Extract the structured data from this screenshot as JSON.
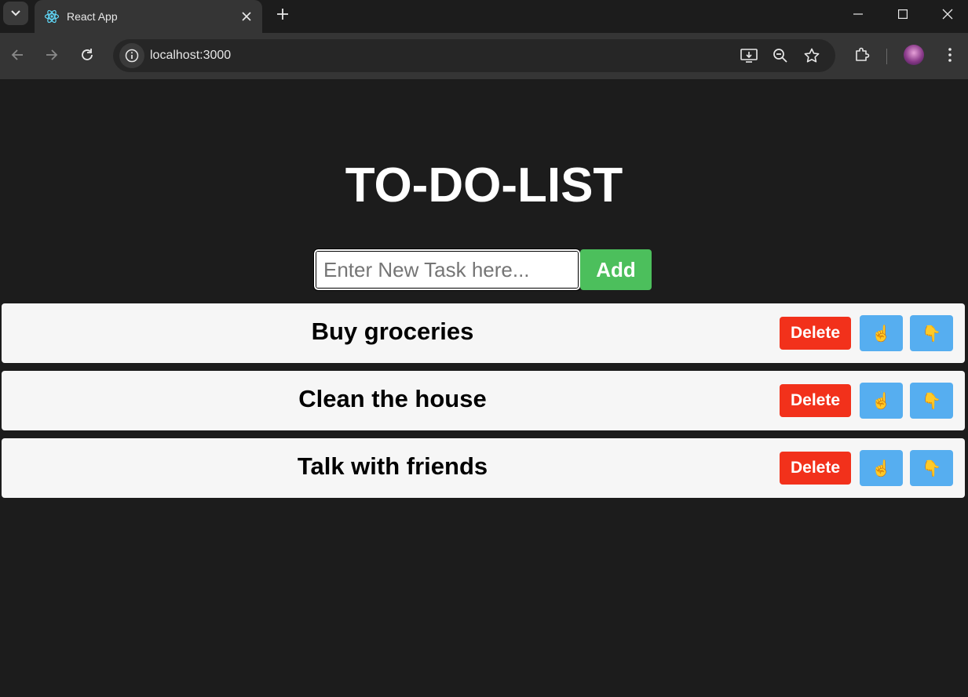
{
  "browser": {
    "tab_title": "React App",
    "url": "localhost:3000"
  },
  "app": {
    "title": "TO-DO-LIST",
    "input_placeholder": "Enter New Task here...",
    "input_value": "",
    "add_label": "Add",
    "delete_label": "Delete",
    "move_up_glyph": "☝️",
    "move_down_glyph": "👇",
    "tasks": [
      {
        "text": "Buy groceries"
      },
      {
        "text": "Clean the house"
      },
      {
        "text": "Talk with friends"
      }
    ]
  },
  "colors": {
    "page_bg": "#1c1c1c",
    "add_button": "#4cbf5c",
    "delete_button": "#f2311b",
    "move_button": "#56aef0",
    "task_bg": "#f6f6f6"
  }
}
